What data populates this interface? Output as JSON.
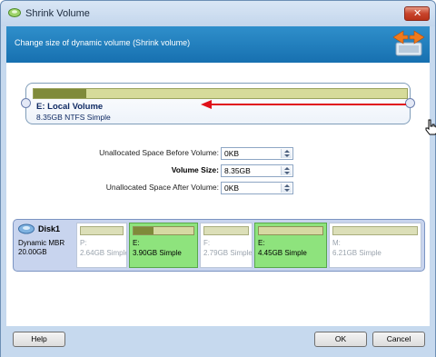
{
  "window": {
    "title": "Shrink Volume"
  },
  "banner": {
    "text": "Change size of dynamic volume (Shrink volume)"
  },
  "volume": {
    "name": "E: Local Volume",
    "detail": "8.35GB NTFS Simple",
    "used_fraction": 0.14
  },
  "fields": [
    {
      "label": "Unallocated Space Before Volume:",
      "value": "0KB",
      "bold": false
    },
    {
      "label": "Volume Size:",
      "value": "8.35GB",
      "bold": true
    },
    {
      "label": "Unallocated Space After Volume:",
      "value": "0KB",
      "bold": false
    }
  ],
  "disk": {
    "name": "Disk1",
    "type": "Dynamic MBR",
    "size": "20.00GB",
    "partitions": [
      {
        "letter": "P:",
        "detail": "2.64GB Simple",
        "selected": false,
        "used_fraction": 0.0
      },
      {
        "letter": "E:",
        "detail": "3.90GB Simple",
        "selected": true,
        "used_fraction": 0.33
      },
      {
        "letter": "F:",
        "detail": "2.79GB Simple",
        "selected": false,
        "used_fraction": 0.0
      },
      {
        "letter": "E:",
        "detail": "4.45GB Simple",
        "selected": true,
        "used_fraction": 0.0
      },
      {
        "letter": "M:",
        "detail": "6.21GB Simple",
        "selected": false,
        "used_fraction": 0.0
      }
    ]
  },
  "buttons": {
    "help": "Help",
    "ok": "OK",
    "cancel": "Cancel"
  },
  "colors": {
    "banner": "#1d7cbd",
    "selected_partition": "#8ee37d",
    "used_space": "#7f8a3a",
    "arrow": "#e0101a"
  }
}
